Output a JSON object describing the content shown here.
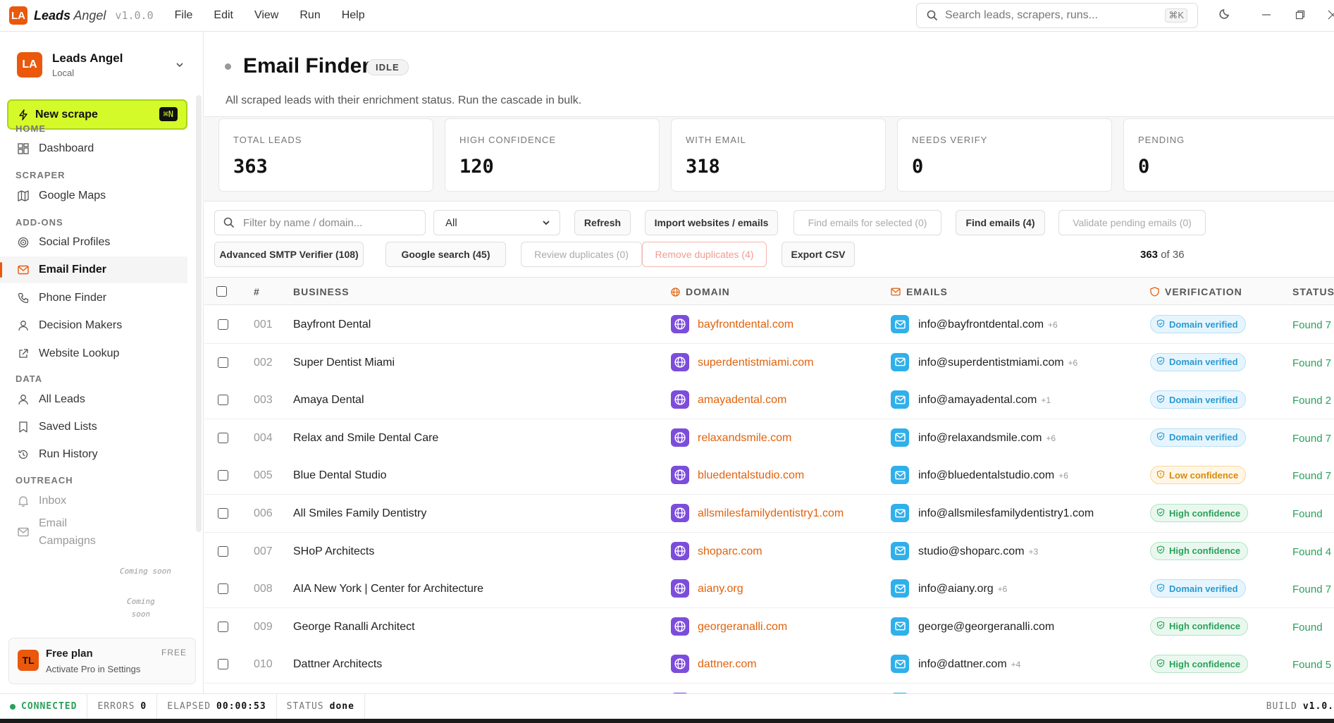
{
  "app": {
    "logo": "LA",
    "name_bold": "Leads",
    "name_rest": "Angel",
    "version": "v1.0.0"
  },
  "menu": [
    "File",
    "Edit",
    "View",
    "Run",
    "Help"
  ],
  "search": {
    "placeholder": "Search leads, scrapers, runs...",
    "shortcut": "⌘K"
  },
  "workspace": {
    "logo": "LA",
    "name": "Leads Angel",
    "sub": "Local"
  },
  "new_scrape": {
    "label": "New scrape",
    "shortcut": "⌘N"
  },
  "sidebar": {
    "home_label": "HOME",
    "dashboard": "Dashboard",
    "scraper_label": "SCRAPER",
    "google_maps": "Google Maps",
    "addons_label": "ADD-ONS",
    "social_profiles": "Social Profiles",
    "email_finder": "Email Finder",
    "phone_finder": "Phone Finder",
    "decision_makers": "Decision Makers",
    "website_lookup": "Website Lookup",
    "data_label": "DATA",
    "all_leads": "All Leads",
    "saved_lists": "Saved Lists",
    "run_history": "Run History",
    "outreach_label": "OUTREACH",
    "inbox": "Inbox",
    "inbox_soon": "Coming soon",
    "campaigns_1": "Email",
    "campaigns_2": "Campaigns",
    "campaigns_soon_1": "Coming",
    "campaigns_soon_2": "soon"
  },
  "plan": {
    "logo": "TL",
    "name": "Free plan",
    "sub": "Activate Pro in Settings",
    "badge": "FREE"
  },
  "page": {
    "title": "Email Finder",
    "status": "IDLE",
    "subtitle": "All scraped leads with their enrichment status. Run the cascade in bulk."
  },
  "stats": [
    {
      "label": "TOTAL LEADS",
      "value": "363"
    },
    {
      "label": "HIGH CONFIDENCE",
      "value": "120"
    },
    {
      "label": "WITH EMAIL",
      "value": "318"
    },
    {
      "label": "NEEDS VERIFY",
      "value": "0"
    },
    {
      "label": "PENDING",
      "value": "0"
    }
  ],
  "toolbar": {
    "filter_placeholder": "Filter by name / domain...",
    "select_value": "All",
    "refresh": "Refresh",
    "import": "Import websites / emails",
    "find_selected": "Find emails for selected (0)",
    "find_emails": "Find emails (4)",
    "validate": "Validate pending emails (0)",
    "smtp": "Advanced SMTP Verifier (108)",
    "google": "Google search (45)",
    "review_dup": "Review duplicates (0)",
    "remove_dup": "Remove duplicates (4)",
    "export": "Export CSV",
    "count_shown": "363",
    "count_of": "of 36"
  },
  "table": {
    "headers": {
      "num": "#",
      "business": "BUSINESS",
      "domain": "DOMAIN",
      "emails": "EMAILS",
      "verification": "VERIFICATION",
      "status": "STATUS"
    },
    "rows": [
      {
        "num": "001",
        "business": "Bayfront Dental",
        "domain": "bayfrontdental.com",
        "email": "info@bayfrontdental.com",
        "more": "+6",
        "verification": "Domain verified",
        "vtype": "blue",
        "status": "Found 7"
      },
      {
        "num": "002",
        "business": "Super Dentist Miami",
        "domain": "superdentistmiami.com",
        "email": "info@superdentistmiami.com",
        "more": "+6",
        "verification": "Domain verified",
        "vtype": "blue",
        "status": "Found 7"
      },
      {
        "num": "003",
        "business": "Amaya Dental",
        "domain": "amayadental.com",
        "email": "info@amayadental.com",
        "more": "+1",
        "verification": "Domain verified",
        "vtype": "blue",
        "status": "Found 2"
      },
      {
        "num": "004",
        "business": "Relax and Smile Dental Care",
        "domain": "relaxandsmile.com",
        "email": "info@relaxandsmile.com",
        "more": "+6",
        "verification": "Domain verified",
        "vtype": "blue",
        "status": "Found 7"
      },
      {
        "num": "005",
        "business": "Blue Dental Studio",
        "domain": "bluedentalstudio.com",
        "email": "info@bluedentalstudio.com",
        "more": "+6",
        "verification": "Low confidence",
        "vtype": "amber",
        "status": "Found 7"
      },
      {
        "num": "006",
        "business": "All Smiles Family Dentistry",
        "domain": "allsmilesfamilydentistry1.com",
        "email": "info@allsmilesfamilydentistry1.com",
        "more": "",
        "verification": "High confidence",
        "vtype": "green",
        "status": "Found"
      },
      {
        "num": "007",
        "business": "SHoP Architects",
        "domain": "shoparc.com",
        "email": "studio@shoparc.com",
        "more": "+3",
        "verification": "High confidence",
        "vtype": "green",
        "status": "Found 4"
      },
      {
        "num": "008",
        "business": "AIA New York | Center for Architecture",
        "domain": "aiany.org",
        "email": "info@aiany.org",
        "more": "+6",
        "verification": "Domain verified",
        "vtype": "blue",
        "status": "Found 7"
      },
      {
        "num": "009",
        "business": "George Ranalli Architect",
        "domain": "georgeranalli.com",
        "email": "george@georgeranalli.com",
        "more": "",
        "verification": "High confidence",
        "vtype": "green",
        "status": "Found"
      },
      {
        "num": "010",
        "business": "Dattner Architects",
        "domain": "dattner.com",
        "email": "info@dattner.com",
        "more": "+4",
        "verification": "High confidence",
        "vtype": "green",
        "status": "Found 5"
      }
    ]
  },
  "statusbar": {
    "connected": "CONNECTED",
    "errors_label": "ERRORS",
    "errors": "0",
    "elapsed_label": "ELAPSED",
    "elapsed": "00:00:53",
    "status_label": "STATUS",
    "status": "done",
    "build_label": "BUILD",
    "build": "v1.0."
  }
}
